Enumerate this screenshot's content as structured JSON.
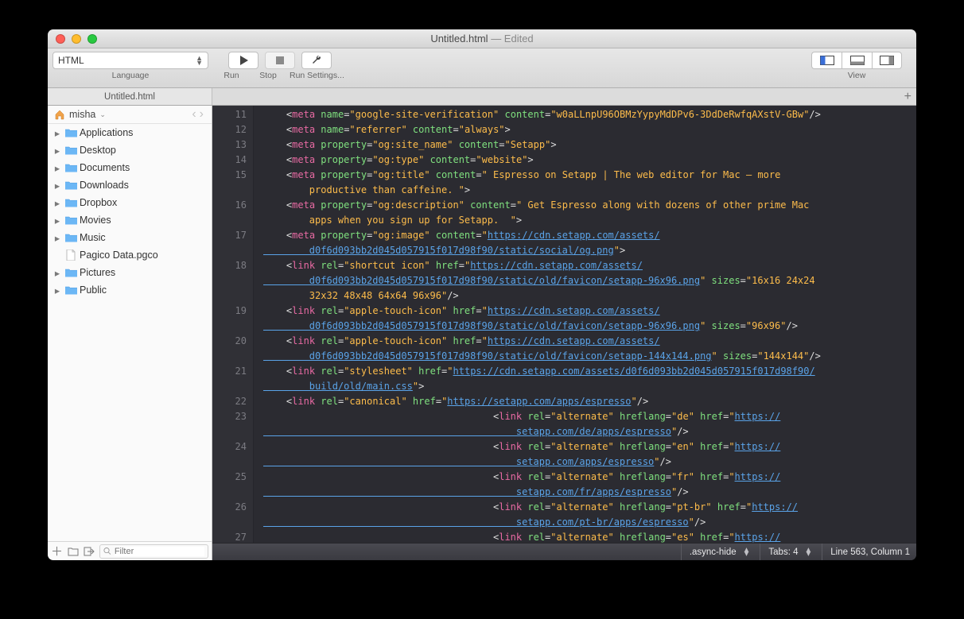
{
  "window": {
    "title": "Untitled.html",
    "edited_suffix": "— Edited"
  },
  "toolbar": {
    "language_value": "HTML",
    "language_label": "Language",
    "run_label": "Run",
    "stop_label": "Stop",
    "run_settings_label": "Run Settings...",
    "view_label": "View"
  },
  "tabbar": {
    "tab1": "Untitled.html"
  },
  "sidebar": {
    "user": "misha",
    "items": [
      {
        "kind": "folder",
        "label": "Applications",
        "hasTriangle": true
      },
      {
        "kind": "folder",
        "label": "Desktop",
        "hasTriangle": true
      },
      {
        "kind": "folder",
        "label": "Documents",
        "hasTriangle": true
      },
      {
        "kind": "folder",
        "label": "Downloads",
        "hasTriangle": true
      },
      {
        "kind": "folder",
        "label": "Dropbox",
        "hasTriangle": true
      },
      {
        "kind": "folder",
        "label": "Movies",
        "hasTriangle": true
      },
      {
        "kind": "folder",
        "label": "Music",
        "hasTriangle": true
      },
      {
        "kind": "file",
        "label": "Pagico Data.pgco",
        "hasTriangle": false
      },
      {
        "kind": "folder",
        "label": "Pictures",
        "hasTriangle": true
      },
      {
        "kind": "folder",
        "label": "Public",
        "hasTriangle": true
      }
    ],
    "filter_placeholder": "Filter"
  },
  "gutter_lines": [
    "11",
    "12",
    "13",
    "14",
    "15",
    "",
    "16",
    "",
    "17",
    "",
    "18",
    "",
    "",
    "19",
    "",
    "20",
    "",
    "21",
    "",
    "22",
    "23",
    "",
    "24",
    "",
    "25",
    "",
    "26",
    "",
    "27"
  ],
  "code_html": "    <span class='ang'>&lt;</span><span class='tag'>meta</span> <span class='attr'>name</span><span class='eq'>=</span><span class='str'>\"google-site-verification\"</span> <span class='attr'>content</span><span class='eq'>=</span><span class='str'>\"w0aLLnpU96OBMzYypyMdDPv6-3DdDeRwfqAXstV-GBw\"</span><span class='ang'>/&gt;</span>\n    <span class='ang'>&lt;</span><span class='tag'>meta</span> <span class='attr'>name</span><span class='eq'>=</span><span class='str'>\"referrer\"</span> <span class='attr'>content</span><span class='eq'>=</span><span class='str'>\"always\"</span><span class='ang'>&gt;</span>\n    <span class='ang'>&lt;</span><span class='tag'>meta</span> <span class='attr'>property</span><span class='eq'>=</span><span class='str'>\"og:site_name\"</span> <span class='attr'>content</span><span class='eq'>=</span><span class='str'>\"Setapp\"</span><span class='ang'>&gt;</span>\n    <span class='ang'>&lt;</span><span class='tag'>meta</span> <span class='attr'>property</span><span class='eq'>=</span><span class='str'>\"og:type\"</span> <span class='attr'>content</span><span class='eq'>=</span><span class='str'>\"website\"</span><span class='ang'>&gt;</span>\n    <span class='ang'>&lt;</span><span class='tag'>meta</span> <span class='attr'>property</span><span class='eq'>=</span><span class='str'>\"og:title\"</span> <span class='attr'>content</span><span class='eq'>=</span><span class='str'>\" Espresso on Setapp | The web editor for Mac – more\n        productive than caffeine. \"</span><span class='ang'>&gt;</span>\n    <span class='ang'>&lt;</span><span class='tag'>meta</span> <span class='attr'>property</span><span class='eq'>=</span><span class='str'>\"og:description\"</span> <span class='attr'>content</span><span class='eq'>=</span><span class='str'>\" Get Espresso along with dozens of other prime Mac\n        apps when you sign up for Setapp.  \"</span><span class='ang'>&gt;</span>\n    <span class='ang'>&lt;</span><span class='tag'>meta</span> <span class='attr'>property</span><span class='eq'>=</span><span class='str'>\"og:image\"</span> <span class='attr'>content</span><span class='eq'>=</span><span class='str'>\"</span><span class='link'>https://cdn.setapp.com/assets/\n        d0f6d093bb2d045d057915f017d98f90/static/social/og.png</span><span class='str'>\"</span><span class='ang'>&gt;</span>\n    <span class='ang'>&lt;</span><span class='tag'>link</span> <span class='attr'>rel</span><span class='eq'>=</span><span class='str'>\"shortcut icon\"</span> <span class='attr'>href</span><span class='eq'>=</span><span class='str'>\"</span><span class='link'>https://cdn.setapp.com/assets/\n        d0f6d093bb2d045d057915f017d98f90/static/old/favicon/setapp-96x96.png</span><span class='str'>\"</span> <span class='attr'>sizes</span><span class='eq'>=</span><span class='str'>\"16x16 24x24\n        32x32 48x48 64x64 96x96\"</span><span class='ang'>/&gt;</span>\n    <span class='ang'>&lt;</span><span class='tag'>link</span> <span class='attr'>rel</span><span class='eq'>=</span><span class='str'>\"apple-touch-icon\"</span> <span class='attr'>href</span><span class='eq'>=</span><span class='str'>\"</span><span class='link'>https://cdn.setapp.com/assets/\n        d0f6d093bb2d045d057915f017d98f90/static/old/favicon/setapp-96x96.png</span><span class='str'>\"</span> <span class='attr'>sizes</span><span class='eq'>=</span><span class='str'>\"96x96\"</span><span class='ang'>/&gt;</span>\n    <span class='ang'>&lt;</span><span class='tag'>link</span> <span class='attr'>rel</span><span class='eq'>=</span><span class='str'>\"apple-touch-icon\"</span> <span class='attr'>href</span><span class='eq'>=</span><span class='str'>\"</span><span class='link'>https://cdn.setapp.com/assets/\n        d0f6d093bb2d045d057915f017d98f90/static/old/favicon/setapp-144x144.png</span><span class='str'>\"</span> <span class='attr'>sizes</span><span class='eq'>=</span><span class='str'>\"144x144\"</span><span class='ang'>/&gt;</span>\n    <span class='ang'>&lt;</span><span class='tag'>link</span> <span class='attr'>rel</span><span class='eq'>=</span><span class='str'>\"stylesheet\"</span> <span class='attr'>href</span><span class='eq'>=</span><span class='str'>\"</span><span class='link'>https://cdn.setapp.com/assets/d0f6d093bb2d045d057915f017d98f90/\n        build/old/main.css</span><span class='str'>\"</span><span class='ang'>&gt;</span>\n    <span class='ang'>&lt;</span><span class='tag'>link</span> <span class='attr'>rel</span><span class='eq'>=</span><span class='str'>\"canonical\"</span> <span class='attr'>href</span><span class='eq'>=</span><span class='str'>\"</span><span class='link'>https://setapp.com/apps/espresso</span><span class='str'>\"</span><span class='ang'>/&gt;</span>\n                                        <span class='ang'>&lt;</span><span class='tag'>link</span> <span class='attr'>rel</span><span class='eq'>=</span><span class='str'>\"alternate\"</span> <span class='attr'>hreflang</span><span class='eq'>=</span><span class='str'>\"de\"</span> <span class='attr'>href</span><span class='eq'>=</span><span class='str'>\"</span><span class='link'>https://\n                                            setapp.com/de/apps/espresso</span><span class='str'>\"</span><span class='ang'>/&gt;</span>\n                                        <span class='ang'>&lt;</span><span class='tag'>link</span> <span class='attr'>rel</span><span class='eq'>=</span><span class='str'>\"alternate\"</span> <span class='attr'>hreflang</span><span class='eq'>=</span><span class='str'>\"en\"</span> <span class='attr'>href</span><span class='eq'>=</span><span class='str'>\"</span><span class='link'>https://\n                                            setapp.com/apps/espresso</span><span class='str'>\"</span><span class='ang'>/&gt;</span>\n                                        <span class='ang'>&lt;</span><span class='tag'>link</span> <span class='attr'>rel</span><span class='eq'>=</span><span class='str'>\"alternate\"</span> <span class='attr'>hreflang</span><span class='eq'>=</span><span class='str'>\"fr\"</span> <span class='attr'>href</span><span class='eq'>=</span><span class='str'>\"</span><span class='link'>https://\n                                            setapp.com/fr/apps/espresso</span><span class='str'>\"</span><span class='ang'>/&gt;</span>\n                                        <span class='ang'>&lt;</span><span class='tag'>link</span> <span class='attr'>rel</span><span class='eq'>=</span><span class='str'>\"alternate\"</span> <span class='attr'>hreflang</span><span class='eq'>=</span><span class='str'>\"pt-br\"</span> <span class='attr'>href</span><span class='eq'>=</span><span class='str'>\"</span><span class='link'>https://\n                                            setapp.com/pt-br/apps/espresso</span><span class='str'>\"</span><span class='ang'>/&gt;</span>\n                                        <span class='ang'>&lt;</span><span class='tag'>link</span> <span class='attr'>rel</span><span class='eq'>=</span><span class='str'>\"alternate\"</span> <span class='attr'>hreflang</span><span class='eq'>=</span><span class='str'>\"es\"</span> <span class='attr'>href</span><span class='eq'>=</span><span class='str'>\"</span><span class='link'>https://</span>",
  "status": {
    "scope": ".async-hide",
    "tabs": "Tabs: 4",
    "cursor": "Line 563, Column 1"
  }
}
